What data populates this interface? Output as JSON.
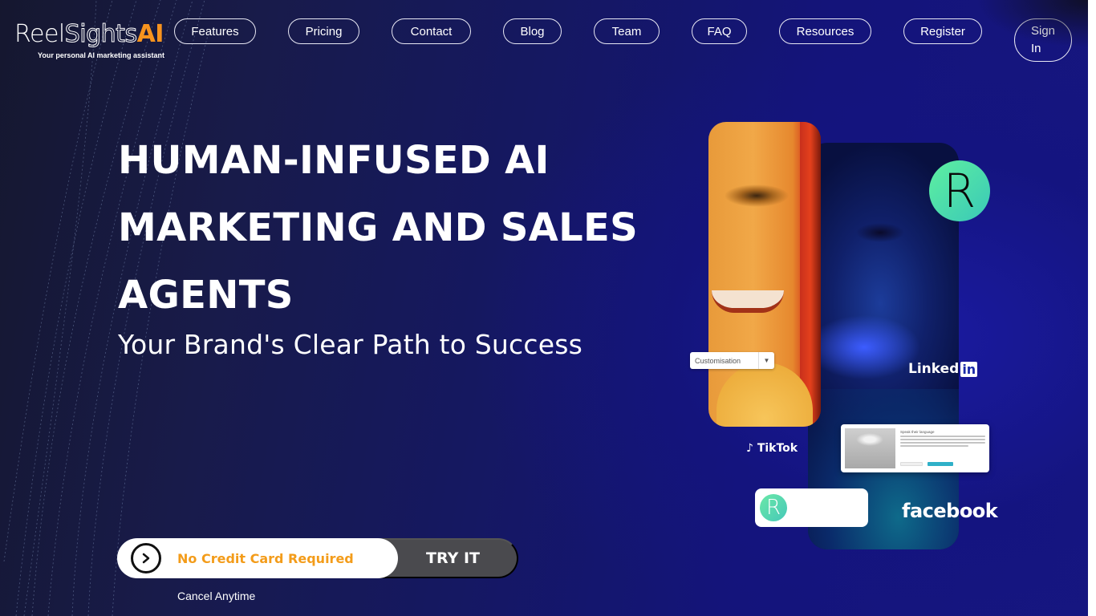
{
  "brand": {
    "name_part1": "Reel",
    "name_part2": "Sights",
    "name_part3": "AI",
    "tagline": "Your personal AI marketing assistant",
    "accent_color": "#f7931e"
  },
  "nav": {
    "items": [
      {
        "label": "Features"
      },
      {
        "label": "Pricing"
      },
      {
        "label": "Contact"
      },
      {
        "label": "Blog"
      },
      {
        "label": "Team"
      },
      {
        "label": "FAQ"
      },
      {
        "label": "Resources"
      },
      {
        "label": "Register"
      }
    ],
    "signin_line1": "Sign",
    "signin_line2": "In"
  },
  "hero": {
    "headline_lines": [
      "HUMAN-INFUSED AI",
      "MARKETING AND SALES",
      "AGENTS"
    ],
    "subheadline": "Your Brand's Clear Path to Success"
  },
  "cta": {
    "icon": "chevron-right-circle-icon",
    "note": "No Credit Card Required",
    "button_label": "TRY IT",
    "subnote": "Cancel Anytime",
    "note_color": "#f39c1a"
  },
  "visual": {
    "dropdown_label": "Customisation",
    "badge_letter": "R",
    "linkedin_label": "Linked",
    "linkedin_in": "in",
    "tiktok_label": "TikTok",
    "tiktok_icon": "♪",
    "facebook_label": "facebook",
    "post_title": "Speak their language"
  }
}
